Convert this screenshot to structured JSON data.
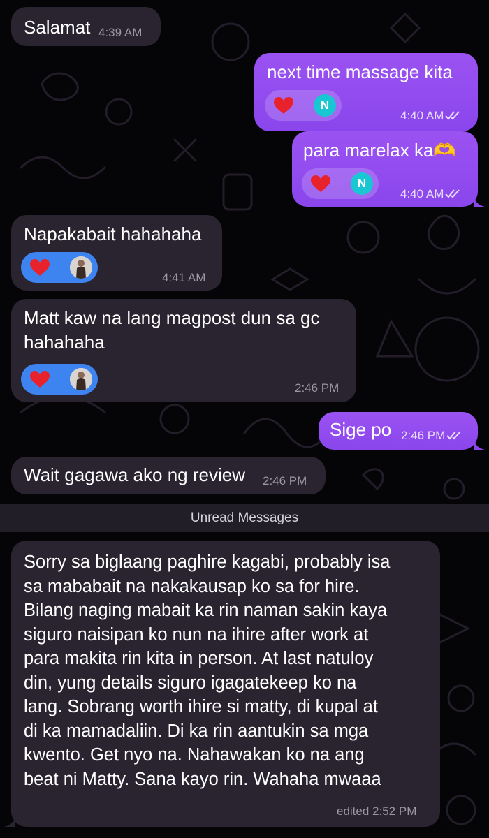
{
  "messages": [
    {
      "text": "Salamat",
      "time": "4:39 AM"
    },
    {
      "text": "next time massage kita",
      "time": "4:40 AM",
      "reaction_avatar": "N"
    },
    {
      "text": "para marelax ka🫶",
      "time": "4:40 AM",
      "reaction_avatar": "N"
    },
    {
      "text": "Napakabait hahahaha",
      "time": "4:41 AM"
    },
    {
      "text": "Matt kaw na lang magpost dun sa gc\nhahahaha",
      "time": "2:46 PM"
    },
    {
      "text": "Sige po",
      "time": "2:46 PM"
    },
    {
      "text": "Wait gagawa ako ng review",
      "time": "2:46 PM"
    },
    {
      "text": "Sorry sa biglaang paghire kagabi, probably isa\nsa mababait na nakakausap ko sa for hire.\nBilang naging mabait ka rin naman sakin kaya\nsiguro naisipan ko nun na ihire after work at\npara makita rin kita in person. At last natuloy\ndin, yung details siguro igagatekeep ko na\nlang. Sobrang worth ihire si matty, di kupal at\ndi ka mamadaliin. Di ka rin aantukin sa mga\nkwento. Get nyo na. Nahawakan ko na ang\nbeat ni Matty. Sana kayo rin. Wahaha mwaaa",
      "time": "edited 2:52 PM"
    }
  ],
  "unread_label": "Unread Messages",
  "icons": {
    "reaction": "heart-icon",
    "read": "double-check-icon"
  },
  "colors": {
    "incoming": "#2a2430",
    "outgoing": "#9b52f2",
    "reaction_in": "#3d84f0",
    "heart": "#e8222a"
  }
}
